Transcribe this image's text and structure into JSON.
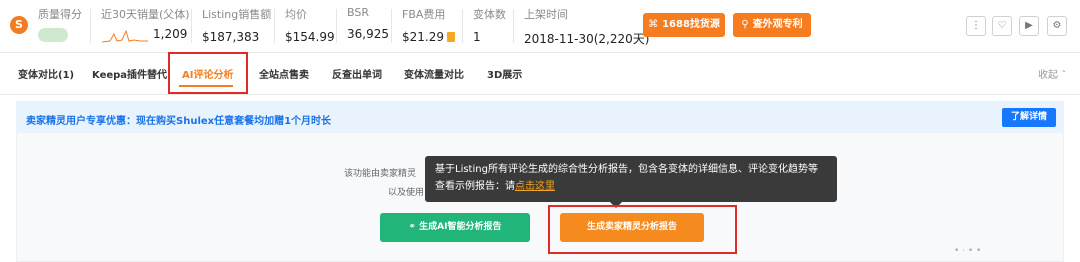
{
  "stats": {
    "quality": {
      "label": "质量得分"
    },
    "sales30": {
      "label": "近30天销量(父体)",
      "value": "1,209"
    },
    "listing_sales": {
      "label": "Listing销售额",
      "value": "$187,383"
    },
    "avg_price": {
      "label": "均价",
      "value": "$154.99"
    },
    "bsr": {
      "label": "BSR",
      "value": "36,925"
    },
    "fba": {
      "label": "FBA费用",
      "value": "$21.29"
    },
    "variants": {
      "label": "变体数",
      "value": "1"
    },
    "listed": {
      "label": "上架时间",
      "value": "2018-11-30(2,220天)"
    }
  },
  "buttons": {
    "find_source": "1688找货源",
    "patent": "查外观专利"
  },
  "tabs": {
    "items": [
      {
        "label": "变体对比(1)"
      },
      {
        "label": "Keepa插件替代"
      },
      {
        "label": "AI评论分析"
      },
      {
        "label": "全站点售卖"
      },
      {
        "label": "反查出单词"
      },
      {
        "label": "变体流量对比"
      },
      {
        "label": "3D展示"
      }
    ],
    "collapse": "收起"
  },
  "promo": {
    "text": "卖家精灵用户专享优惠：现在购买Shulex任意套餐均加赠1个月时长",
    "detail_button": "了解详情"
  },
  "intro": {
    "line1": "该功能由卖家精灵",
    "line2": "以及使用"
  },
  "tooltip": {
    "line1": "基于Listing所有评论生成的综合性分析报告，包含各变体的详细信息、评论变化趋势等",
    "line2_prefix": "查看示例报告：请",
    "line2_link": "点击这里"
  },
  "action_buttons": {
    "ai_report": "生成AI智能分析报告",
    "seller_report": "生成卖家精灵分析报告"
  },
  "colors": {
    "accent": "#f57c1f",
    "highlight_frame": "#e02a2a",
    "green": "#22b57a",
    "blue": "#1677ff"
  }
}
